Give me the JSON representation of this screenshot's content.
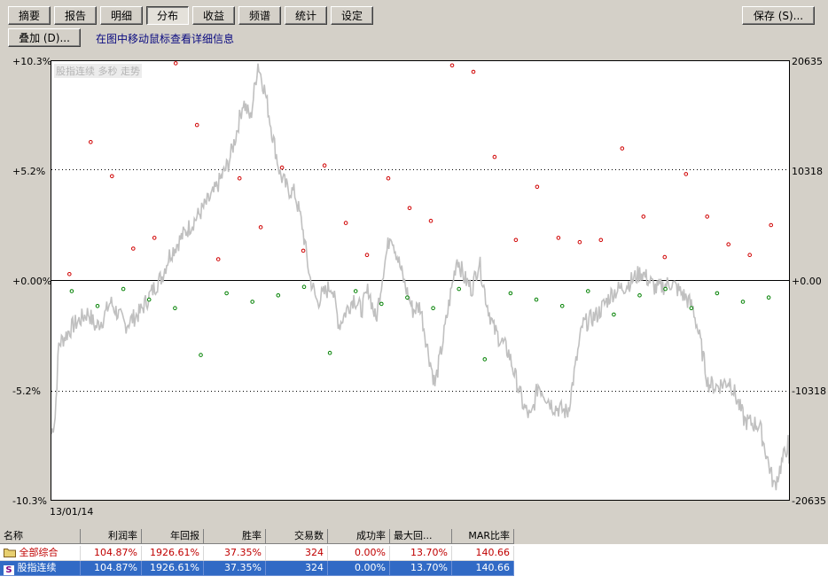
{
  "toolbar": {
    "tabs": [
      {
        "label": "摘要",
        "active": false
      },
      {
        "label": "报告",
        "active": false
      },
      {
        "label": "明细",
        "active": false
      },
      {
        "label": "分布",
        "active": true
      },
      {
        "label": "收益",
        "active": false
      },
      {
        "label": "频谱",
        "active": false
      },
      {
        "label": "统计",
        "active": false
      },
      {
        "label": "设定",
        "active": false
      }
    ],
    "save_label": "保存 (S)...",
    "overlay_label": "叠加 (D)...",
    "hint": "在图中移动鼠标查看详细信息"
  },
  "chart_data": {
    "type": "scatter",
    "title": "股指连续 多秒 走势",
    "x_start_label": "13/01/14",
    "left_axis_ticks": [
      "+10.3%",
      "+5.2%",
      "+0.00%",
      "-5.2%",
      "-10.3%"
    ],
    "right_axis_ticks": [
      "20635",
      "10318",
      "+0.00",
      "-10318",
      "-20635"
    ],
    "ylim": [
      -10.3,
      10.3
    ],
    "grid": "dotted horizontal",
    "price_series": {
      "name": "price",
      "color": "#c0c0c0",
      "x": [
        0,
        0.5,
        1,
        3,
        5,
        6,
        7,
        8,
        10,
        12,
        14,
        15,
        16,
        18,
        20,
        22,
        24,
        25,
        26,
        27,
        28,
        29,
        30,
        31,
        32,
        33,
        34,
        35,
        36,
        37,
        38,
        39,
        40,
        41,
        42,
        43,
        44,
        45,
        46,
        47,
        48,
        49,
        50,
        51,
        52,
        53,
        54,
        55,
        56,
        57,
        58,
        59,
        60,
        62,
        64,
        65,
        66,
        68,
        70,
        72,
        74,
        76,
        78,
        80,
        82,
        84,
        86,
        87,
        88,
        89,
        90,
        92,
        94,
        96,
        98,
        100
      ],
      "y": [
        -7.2,
        -6.4,
        -3.0,
        -2.1,
        -1.5,
        -2.2,
        -1.8,
        -1.0,
        -2.1,
        -1.5,
        -0.3,
        0.2,
        1.2,
        2.2,
        3.1,
        4.1,
        5.5,
        6.8,
        8.4,
        7.6,
        10.2,
        8.8,
        6.8,
        5.0,
        4.3,
        4.1,
        2.6,
        0.2,
        -1.0,
        -0.6,
        -0.2,
        -2.1,
        -1.4,
        -0.8,
        -1.4,
        -0.4,
        -1.9,
        0.5,
        2.3,
        1.0,
        -0.3,
        -1.4,
        -1.2,
        -3.2,
        -4.9,
        -3.0,
        -0.9,
        1.1,
        0.1,
        -0.4,
        0.9,
        -1.0,
        -2.3,
        -3.4,
        -5.9,
        -6.5,
        -4.9,
        -5.9,
        -6.2,
        -2.1,
        -1.6,
        -0.6,
        -0.2,
        0.4,
        -0.4,
        -0.1,
        -0.8,
        -1.3,
        -2.9,
        -4.8,
        -5.0,
        -4.7,
        -6.6,
        -6.8,
        -9.7,
        -7.5,
        -8.3,
        -8.6
      ]
    },
    "trade_markers": {
      "red_y": [
        0.3,
        6.5,
        4.9,
        1.5,
        2.0,
        10.2,
        7.3,
        1.0,
        4.8,
        2.5,
        5.3,
        1.4,
        5.4,
        2.7,
        1.2,
        4.8,
        3.4,
        2.8,
        10.1,
        9.8,
        5.8,
        1.9,
        4.4,
        2.0,
        1.8,
        1.9,
        6.2,
        3.0,
        1.1,
        5.0,
        3.0,
        1.7,
        1.2,
        2.6
      ],
      "green_y": [
        -0.5,
        -1.2,
        -0.4,
        -0.9,
        -1.3,
        -3.5,
        -0.6,
        -1.0,
        -0.7,
        -0.3,
        -3.4,
        -0.5,
        -1.1,
        -0.8,
        -1.3,
        -0.4,
        -3.7,
        -0.6,
        -0.9,
        -1.2,
        -0.5,
        -1.6,
        -0.7,
        -0.4,
        -1.3,
        -0.6,
        -1.0,
        -0.8
      ]
    }
  },
  "table": {
    "columns": [
      "名称",
      "利润率",
      "年回报",
      "胜率",
      "交易数",
      "成功率",
      "最大回...",
      "MAR比率"
    ],
    "rows": [
      {
        "icon": "folder-icon",
        "name": "全部综合",
        "profit": "104.87%",
        "annual": "1926.61%",
        "win": "37.35%",
        "trades": "324",
        "success": "0.00%",
        "maxdd": "13.70%",
        "mar": "140.66"
      },
      {
        "icon": "s-icon",
        "name": "股指连续",
        "profit": "104.87%",
        "annual": "1926.61%",
        "win": "37.35%",
        "trades": "324",
        "success": "0.00%",
        "maxdd": "13.70%",
        "mar": "140.66"
      }
    ]
  }
}
